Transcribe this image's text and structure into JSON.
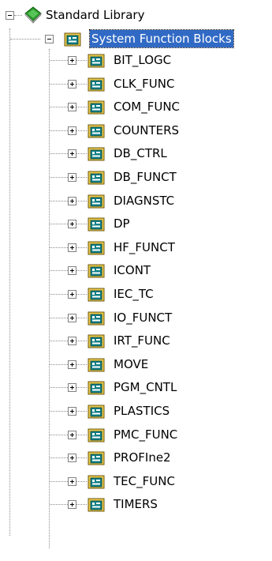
{
  "tree": {
    "root": {
      "label": "Standard Library",
      "icon": "library-book-icon",
      "expanded": true
    },
    "folder": {
      "label": "System Function Blocks",
      "icon": "function-block-folder-icon",
      "expanded": true,
      "selected": true
    },
    "items": [
      {
        "label": "BIT_LOGC"
      },
      {
        "label": "CLK_FUNC"
      },
      {
        "label": "COM_FUNC"
      },
      {
        "label": "COUNTERS"
      },
      {
        "label": "DB_CTRL"
      },
      {
        "label": "DB_FUNCT"
      },
      {
        "label": "DIAGNSTC"
      },
      {
        "label": "DP"
      },
      {
        "label": "HF_FUNCT"
      },
      {
        "label": "ICONT"
      },
      {
        "label": "IEC_TC"
      },
      {
        "label": "IO_FUNCT"
      },
      {
        "label": "IRT_FUNC"
      },
      {
        "label": "MOVE"
      },
      {
        "label": "PGM_CNTL"
      },
      {
        "label": "PLASTICS"
      },
      {
        "label": "PMC_FUNC"
      },
      {
        "label": "PROFIne2"
      },
      {
        "label": "TEC_FUNC"
      },
      {
        "label": "TIMERS"
      }
    ],
    "colors": {
      "selection": "#316ac5",
      "connector": "#8c8c8c",
      "block_icon_teal": "#0f7f86",
      "block_icon_yellow": "#e8c84a",
      "root_icon_green": "#2a9a2a"
    }
  }
}
